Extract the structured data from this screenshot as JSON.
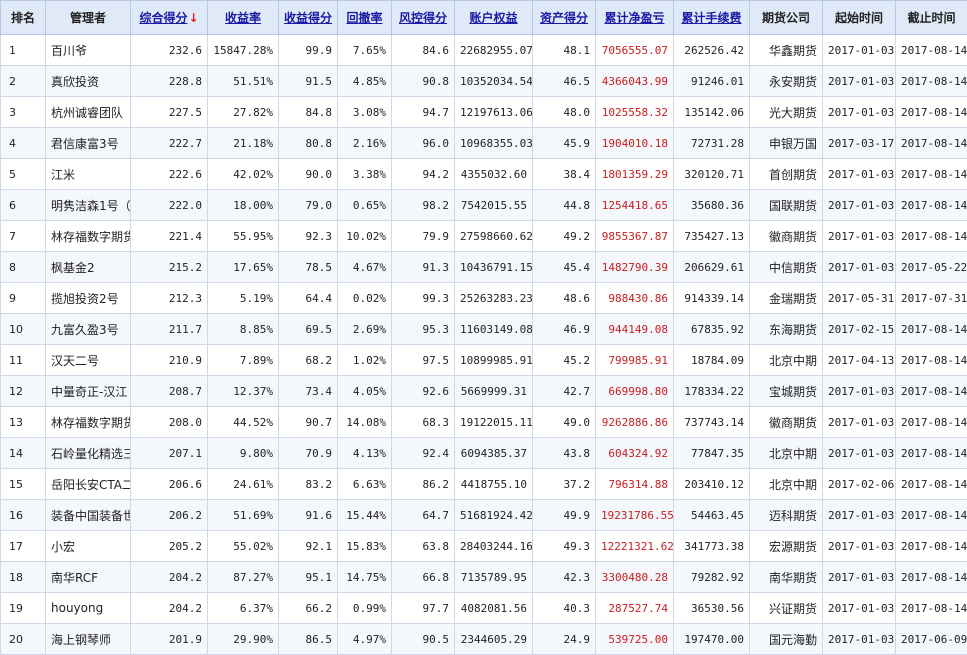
{
  "headers": {
    "rank": "排名",
    "manager": "管理者",
    "composite": "综合得分",
    "sort_arrow": "↓",
    "return_rate": "收益率",
    "return_score": "收益得分",
    "drawdown": "回撤率",
    "risk_score": "风控得分",
    "equity": "账户权益",
    "asset_score": "资产得分",
    "net_profit": "累计净盈亏",
    "fees": "累计手续费",
    "company": "期货公司",
    "start": "起始时间",
    "end": "截止时间"
  },
  "rows": [
    {
      "rank": "1",
      "manager": "百川爷",
      "composite": "232.6",
      "return_rate": "15847.28%",
      "return_score": "99.9",
      "drawdown": "7.65%",
      "risk_score": "84.6",
      "equity": "22682955.07",
      "asset_score": "48.1",
      "net_profit": "7056555.07",
      "fees": "262526.42",
      "company": "华鑫期货",
      "start": "2017-01-03",
      "end": "2017-08-14"
    },
    {
      "rank": "2",
      "manager": "真欣投资",
      "composite": "228.8",
      "return_rate": "51.51%",
      "return_score": "91.5",
      "drawdown": "4.85%",
      "risk_score": "90.8",
      "equity": "10352034.54",
      "asset_score": "46.5",
      "net_profit": "4366043.99",
      "fees": "91246.01",
      "company": "永安期货",
      "start": "2017-01-03",
      "end": "2017-08-14"
    },
    {
      "rank": "3",
      "manager": "杭州诚睿团队",
      "composite": "227.5",
      "return_rate": "27.82%",
      "return_score": "84.8",
      "drawdown": "3.08%",
      "risk_score": "94.7",
      "equity": "12197613.06",
      "asset_score": "48.0",
      "net_profit": "1025558.32",
      "fees": "135142.06",
      "company": "光大期货",
      "start": "2017-01-03",
      "end": "2017-08-14"
    },
    {
      "rank": "4",
      "manager": "君信康富3号",
      "composite": "222.7",
      "return_rate": "21.18%",
      "return_score": "80.8",
      "drawdown": "2.16%",
      "risk_score": "96.0",
      "equity": "10968355.03",
      "asset_score": "45.9",
      "net_profit": "1904010.18",
      "fees": "72731.28",
      "company": "申银万国",
      "start": "2017-03-17",
      "end": "2017-08-14"
    },
    {
      "rank": "5",
      "manager": "江米",
      "composite": "222.6",
      "return_rate": "42.02%",
      "return_score": "90.0",
      "drawdown": "3.38%",
      "risk_score": "94.2",
      "equity": "4355032.60",
      "asset_score": "38.4",
      "net_profit": "1801359.29",
      "fees": "320120.71",
      "company": "首创期货",
      "start": "2017-01-03",
      "end": "2017-08-14"
    },
    {
      "rank": "6",
      "manager": "明隽洁森1号（",
      "composite": "222.0",
      "return_rate": "18.00%",
      "return_score": "79.0",
      "drawdown": "0.65%",
      "risk_score": "98.2",
      "equity": "7542015.55",
      "asset_score": "44.8",
      "net_profit": "1254418.65",
      "fees": "35680.36",
      "company": "国联期货",
      "start": "2017-01-03",
      "end": "2017-08-14"
    },
    {
      "rank": "7",
      "manager": "林存福数字期货",
      "composite": "221.4",
      "return_rate": "55.95%",
      "return_score": "92.3",
      "drawdown": "10.02%",
      "risk_score": "79.9",
      "equity": "27598660.62",
      "asset_score": "49.2",
      "net_profit": "9855367.87",
      "fees": "735427.13",
      "company": "徽商期货",
      "start": "2017-01-03",
      "end": "2017-08-14"
    },
    {
      "rank": "8",
      "manager": "枫基金2",
      "composite": "215.2",
      "return_rate": "17.65%",
      "return_score": "78.5",
      "drawdown": "4.67%",
      "risk_score": "91.3",
      "equity": "10436791.15",
      "asset_score": "45.4",
      "net_profit": "1482790.39",
      "fees": "206629.61",
      "company": "中信期货",
      "start": "2017-01-03",
      "end": "2017-05-22"
    },
    {
      "rank": "9",
      "manager": "揽旭投资2号",
      "composite": "212.3",
      "return_rate": "5.19%",
      "return_score": "64.4",
      "drawdown": "0.02%",
      "risk_score": "99.3",
      "equity": "25263283.23",
      "asset_score": "48.6",
      "net_profit": "988430.86",
      "fees": "914339.14",
      "company": "金瑞期货",
      "start": "2017-05-31",
      "end": "2017-07-31"
    },
    {
      "rank": "10",
      "manager": "九富久盈3号",
      "composite": "211.7",
      "return_rate": "8.85%",
      "return_score": "69.5",
      "drawdown": "2.69%",
      "risk_score": "95.3",
      "equity": "11603149.08",
      "asset_score": "46.9",
      "net_profit": "944149.08",
      "fees": "67835.92",
      "company": "东海期货",
      "start": "2017-02-15",
      "end": "2017-08-14"
    },
    {
      "rank": "11",
      "manager": "汉天二号",
      "composite": "210.9",
      "return_rate": "7.89%",
      "return_score": "68.2",
      "drawdown": "1.02%",
      "risk_score": "97.5",
      "equity": "10899985.91",
      "asset_score": "45.2",
      "net_profit": "799985.91",
      "fees": "18784.09",
      "company": "北京中期",
      "start": "2017-04-13",
      "end": "2017-08-14"
    },
    {
      "rank": "12",
      "manager": "中量奇正-汉江",
      "composite": "208.7",
      "return_rate": "12.37%",
      "return_score": "73.4",
      "drawdown": "4.05%",
      "risk_score": "92.6",
      "equity": "5669999.31",
      "asset_score": "42.7",
      "net_profit": "669998.80",
      "fees": "178334.22",
      "company": "宝城期货",
      "start": "2017-01-03",
      "end": "2017-08-14"
    },
    {
      "rank": "13",
      "manager": "林存福数字期货",
      "composite": "208.0",
      "return_rate": "44.52%",
      "return_score": "90.7",
      "drawdown": "14.08%",
      "risk_score": "68.3",
      "equity": "19122015.11",
      "asset_score": "49.0",
      "net_profit": "9262886.86",
      "fees": "737743.14",
      "company": "徽商期货",
      "start": "2017-01-03",
      "end": "2017-08-14"
    },
    {
      "rank": "14",
      "manager": "石岭量化精选三",
      "composite": "207.1",
      "return_rate": "9.80%",
      "return_score": "70.9",
      "drawdown": "4.13%",
      "risk_score": "92.4",
      "equity": "6094385.37",
      "asset_score": "43.8",
      "net_profit": "604324.92",
      "fees": "77847.35",
      "company": "北京中期",
      "start": "2017-01-03",
      "end": "2017-08-14"
    },
    {
      "rank": "15",
      "manager": "岳阳长安CTA二",
      "composite": "206.6",
      "return_rate": "24.61%",
      "return_score": "83.2",
      "drawdown": "6.63%",
      "risk_score": "86.2",
      "equity": "4418755.10",
      "asset_score": "37.2",
      "net_profit": "796314.88",
      "fees": "203410.12",
      "company": "北京中期",
      "start": "2017-02-06",
      "end": "2017-08-14"
    },
    {
      "rank": "16",
      "manager": "装备中国装备世",
      "composite": "206.2",
      "return_rate": "51.69%",
      "return_score": "91.6",
      "drawdown": "15.44%",
      "risk_score": "64.7",
      "equity": "51681924.42",
      "asset_score": "49.9",
      "net_profit": "19231786.55",
      "fees": "54463.45",
      "company": "迈科期货",
      "start": "2017-01-03",
      "end": "2017-08-14"
    },
    {
      "rank": "17",
      "manager": "小宏",
      "composite": "205.2",
      "return_rate": "55.02%",
      "return_score": "92.1",
      "drawdown": "15.83%",
      "risk_score": "63.8",
      "equity": "28403244.16",
      "asset_score": "49.3",
      "net_profit": "12221321.62",
      "fees": "341773.38",
      "company": "宏源期货",
      "start": "2017-01-03",
      "end": "2017-08-14"
    },
    {
      "rank": "18",
      "manager": "南华RCF",
      "composite": "204.2",
      "return_rate": "87.27%",
      "return_score": "95.1",
      "drawdown": "14.75%",
      "risk_score": "66.8",
      "equity": "7135789.95",
      "asset_score": "42.3",
      "net_profit": "3300480.28",
      "fees": "79282.92",
      "company": "南华期货",
      "start": "2017-01-03",
      "end": "2017-08-14"
    },
    {
      "rank": "19",
      "manager": "houyong",
      "composite": "204.2",
      "return_rate": "6.37%",
      "return_score": "66.2",
      "drawdown": "0.99%",
      "risk_score": "97.7",
      "equity": "4082081.56",
      "asset_score": "40.3",
      "net_profit": "287527.74",
      "fees": "36530.56",
      "company": "兴证期货",
      "start": "2017-01-03",
      "end": "2017-08-14"
    },
    {
      "rank": "20",
      "manager": "海上钢琴师",
      "composite": "201.9",
      "return_rate": "29.90%",
      "return_score": "86.5",
      "drawdown": "4.97%",
      "risk_score": "90.5",
      "equity": "2344605.29",
      "asset_score": "24.9",
      "net_profit": "539725.00",
      "fees": "197470.00",
      "company": "国元海勤",
      "start": "2017-01-03",
      "end": "2017-06-09"
    }
  ]
}
